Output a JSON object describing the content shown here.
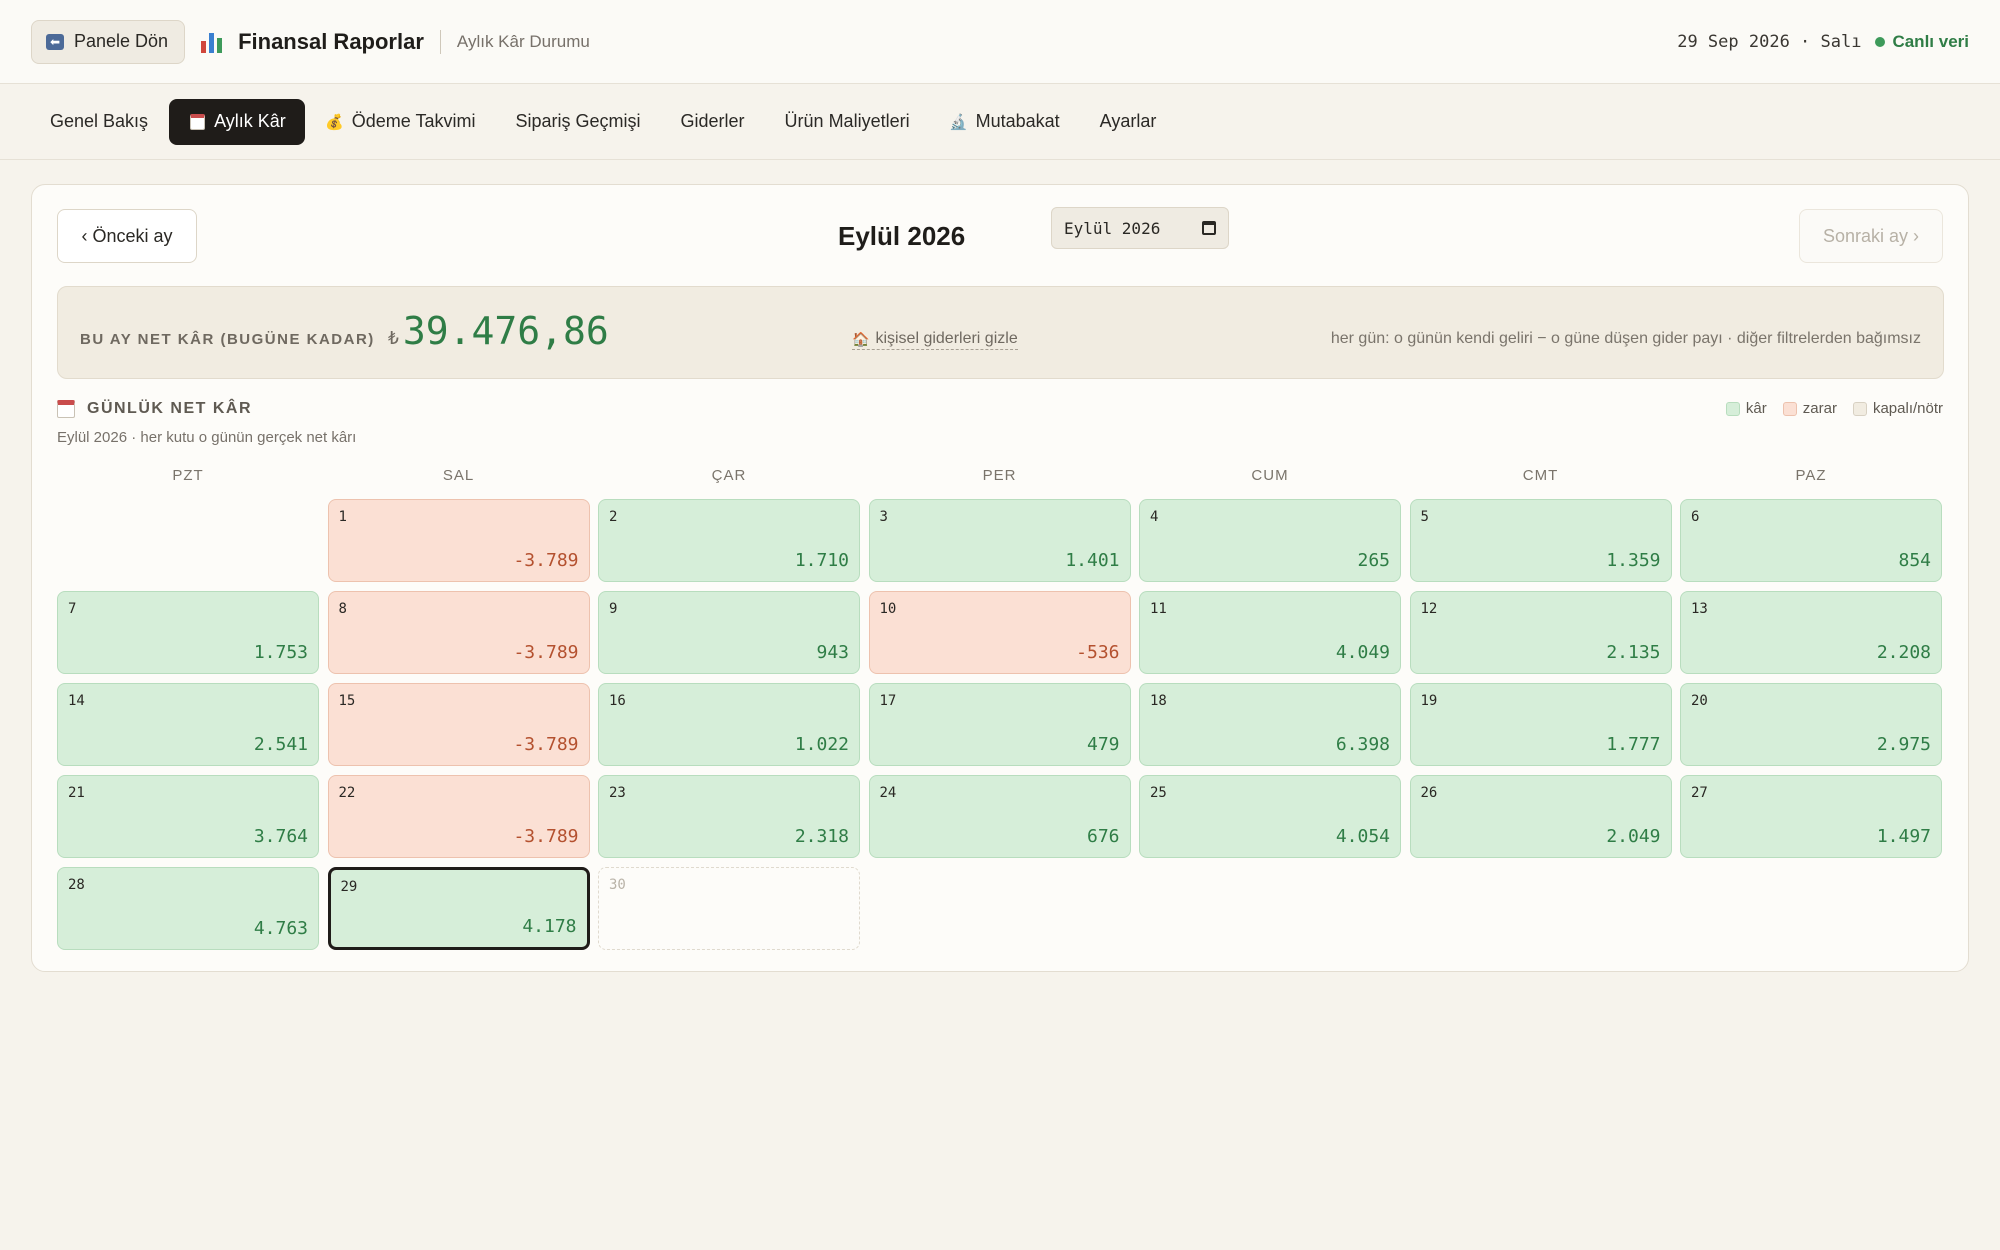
{
  "header": {
    "back_label": "Panele Dön",
    "back_icon": "back-arrow-icon",
    "title": "Finansal Raporlar",
    "subtitle": "Aylık Kâr Durumu",
    "date": "29 Sep 2026 · Salı",
    "live_label": "Canlı veri",
    "live_color": "#3d9a5a"
  },
  "tabs": [
    {
      "label": "Genel Bakış",
      "icon": "",
      "active": false
    },
    {
      "label": "Aylık Kâr",
      "icon": "calendar-icon",
      "active": true
    },
    {
      "label": "Ödeme Takvimi",
      "icon": "money-bag-icon",
      "active": false
    },
    {
      "label": "Sipariş Geçmişi",
      "icon": "",
      "active": false
    },
    {
      "label": "Giderler",
      "icon": "",
      "active": false
    },
    {
      "label": "Ürün Maliyetleri",
      "icon": "",
      "active": false
    },
    {
      "label": "Mutabakat",
      "icon": "microscope-icon",
      "active": false
    },
    {
      "label": "Ayarlar",
      "icon": "",
      "active": false
    }
  ],
  "nav": {
    "prev_label": "‹ Önceki ay",
    "next_label": "Sonraki ay ›",
    "month_title": "Eylül 2026",
    "month_input_value": "Eylül 2026"
  },
  "summary": {
    "label": "BU AY NET KÂR (BUGÜNE KADAR)",
    "currency": "₺",
    "value": "39.476,86",
    "hide_link": "kişisel giderleri gizle",
    "note": "her gün: o günün kendi geliri − o güne düşen gider payı · diğer filtrelerden bağımsız"
  },
  "section": {
    "title": "GÜNLÜK NET KÂR",
    "subtitle": "Eylül 2026 · her kutu o günün gerçek net kârı"
  },
  "legend": [
    {
      "label": "kâr",
      "color": "#d6eed9",
      "border": "#b8ddbe"
    },
    {
      "label": "zarar",
      "color": "#fbe0d4",
      "border": "#edc2ae"
    },
    {
      "label": "kapalı/nötr",
      "color": "#f1ece1",
      "border": "#d8d1c3"
    }
  ],
  "weekdays": [
    "PZT",
    "SAL",
    "ÇAR",
    "PER",
    "CUM",
    "CMT",
    "PAZ"
  ],
  "calendar": {
    "start_weekday": 1,
    "today": 29,
    "days": [
      {
        "day": "1",
        "value": "-3.789",
        "type": "neg"
      },
      {
        "day": "2",
        "value": "1.710",
        "type": "pos"
      },
      {
        "day": "3",
        "value": "1.401",
        "type": "pos"
      },
      {
        "day": "4",
        "value": "265",
        "type": "pos"
      },
      {
        "day": "5",
        "value": "1.359",
        "type": "pos"
      },
      {
        "day": "6",
        "value": "854",
        "type": "pos"
      },
      {
        "day": "7",
        "value": "1.753",
        "type": "pos"
      },
      {
        "day": "8",
        "value": "-3.789",
        "type": "neg"
      },
      {
        "day": "9",
        "value": "943",
        "type": "pos"
      },
      {
        "day": "10",
        "value": "-536",
        "type": "neg"
      },
      {
        "day": "11",
        "value": "4.049",
        "type": "pos"
      },
      {
        "day": "12",
        "value": "2.135",
        "type": "pos"
      },
      {
        "day": "13",
        "value": "2.208",
        "type": "pos"
      },
      {
        "day": "14",
        "value": "2.541",
        "type": "pos"
      },
      {
        "day": "15",
        "value": "-3.789",
        "type": "neg"
      },
      {
        "day": "16",
        "value": "1.022",
        "type": "pos"
      },
      {
        "day": "17",
        "value": "479",
        "type": "pos"
      },
      {
        "day": "18",
        "value": "6.398",
        "type": "pos"
      },
      {
        "day": "19",
        "value": "1.777",
        "type": "pos"
      },
      {
        "day": "20",
        "value": "2.975",
        "type": "pos"
      },
      {
        "day": "21",
        "value": "3.764",
        "type": "pos"
      },
      {
        "day": "22",
        "value": "-3.789",
        "type": "neg"
      },
      {
        "day": "23",
        "value": "2.318",
        "type": "pos"
      },
      {
        "day": "24",
        "value": "676",
        "type": "pos"
      },
      {
        "day": "25",
        "value": "4.054",
        "type": "pos"
      },
      {
        "day": "26",
        "value": "2.049",
        "type": "pos"
      },
      {
        "day": "27",
        "value": "1.497",
        "type": "pos"
      },
      {
        "day": "28",
        "value": "4.763",
        "type": "pos"
      },
      {
        "day": "29",
        "value": "4.178",
        "type": "pos"
      },
      {
        "day": "30",
        "value": "",
        "type": "empty"
      }
    ]
  }
}
